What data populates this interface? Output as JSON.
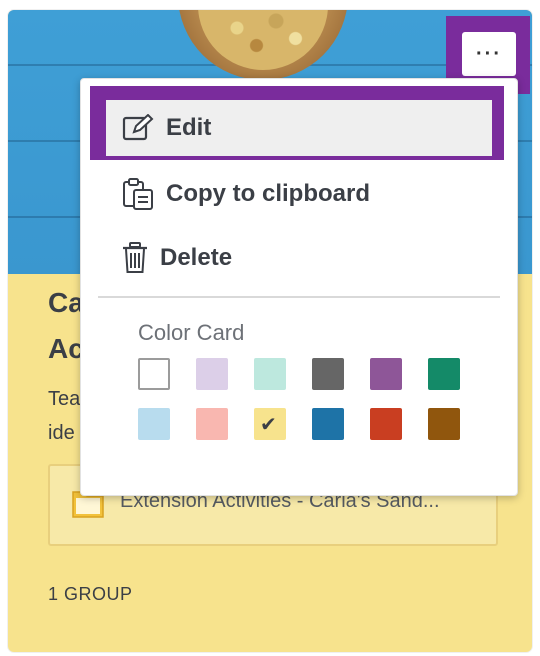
{
  "card": {
    "title_partial_line1": "Ca",
    "title_partial_line2": "Ac",
    "desc_partial_line1": "Tea",
    "desc_partial_line2": "ide",
    "resource_label": "Extension Activities - Carla's Sand...",
    "group_count": "1 GROUP",
    "more_button_label": "···"
  },
  "menu": {
    "items": [
      {
        "label": "Edit",
        "icon": "edit-icon"
      },
      {
        "label": "Copy to clipboard",
        "icon": "clipboard-icon"
      },
      {
        "label": "Delete",
        "icon": "trash-icon"
      }
    ],
    "color_section_label": "Color Card",
    "colors": [
      {
        "name": "white",
        "hex": "#ffffff",
        "selected": false
      },
      {
        "name": "lavender",
        "hex": "#dccfe8",
        "selected": false
      },
      {
        "name": "mint",
        "hex": "#bde8de",
        "selected": false
      },
      {
        "name": "gray",
        "hex": "#666666",
        "selected": false
      },
      {
        "name": "purple",
        "hex": "#8e5698",
        "selected": false
      },
      {
        "name": "green",
        "hex": "#148a68",
        "selected": false
      },
      {
        "name": "light-blue",
        "hex": "#b8dcee",
        "selected": false
      },
      {
        "name": "pink",
        "hex": "#f9b7b0",
        "selected": false
      },
      {
        "name": "yellow",
        "hex": "#f7e38d",
        "selected": true
      },
      {
        "name": "blue",
        "hex": "#1e73a7",
        "selected": false
      },
      {
        "name": "red",
        "hex": "#c93e21",
        "selected": false
      },
      {
        "name": "brown",
        "hex": "#90560d",
        "selected": false
      }
    ]
  },
  "colors": {
    "highlight": "#7a2c9c",
    "card_background": "#f7e38d",
    "image_blue": "#3f9fd6"
  }
}
